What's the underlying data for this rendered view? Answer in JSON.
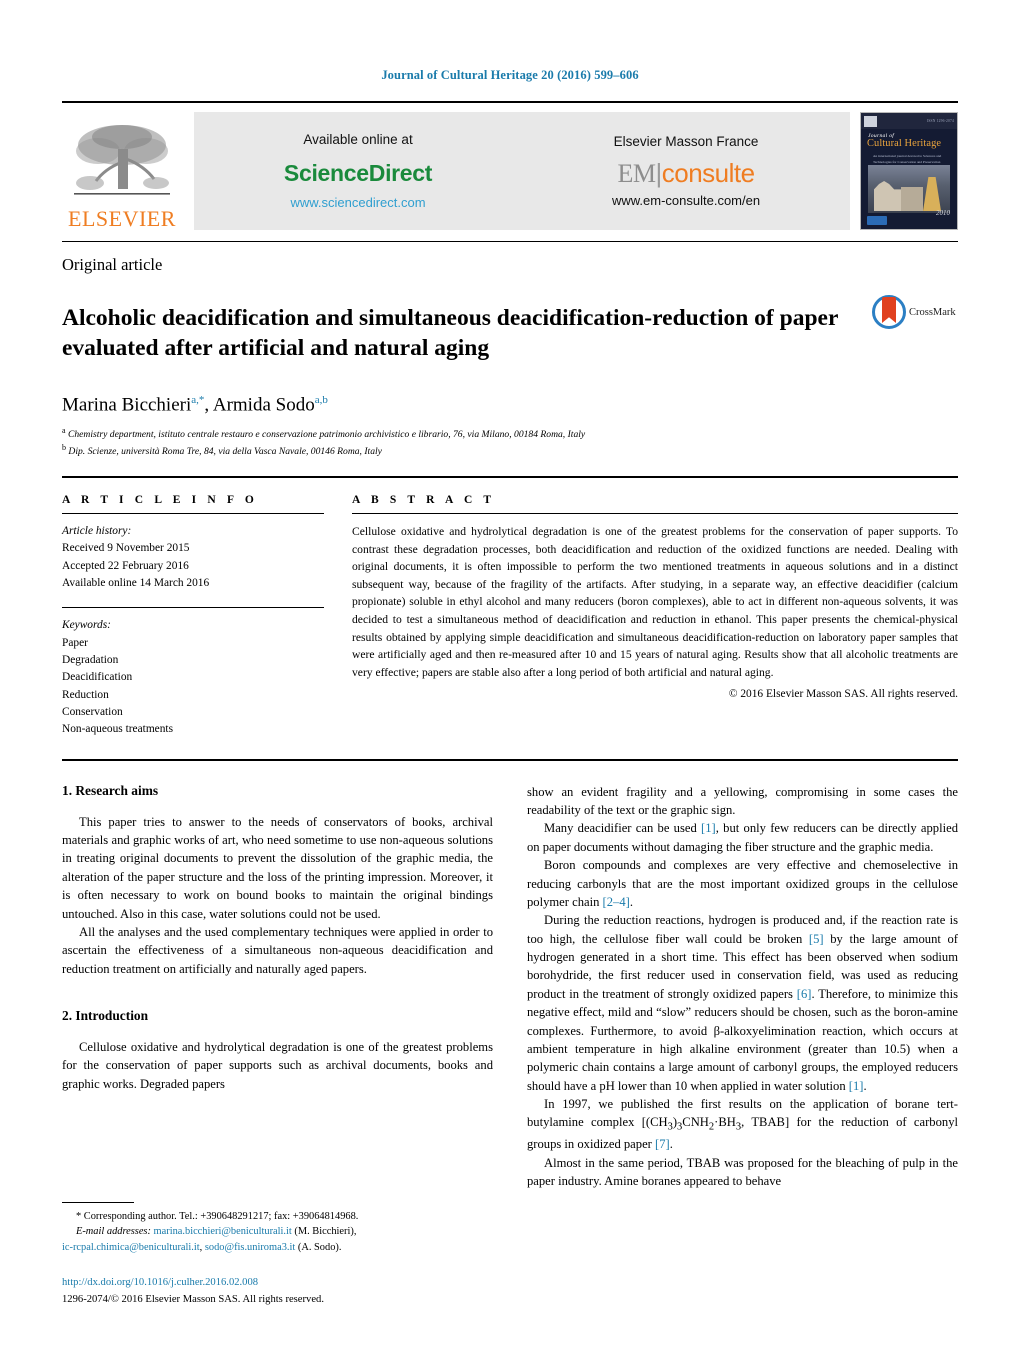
{
  "running_head": "Journal of Cultural Heritage 20 (2016) 599–606",
  "masthead": {
    "elsevier_wordmark": "ELSEVIER",
    "available_online": "Available online at",
    "sciencedirect": "ScienceDirect",
    "sciencedirect_url": "www.sciencedirect.com",
    "publisher": "Elsevier Masson France",
    "em_prefix": "EM",
    "em_suffix": "consulte",
    "em_url": "www.em-consulte.com/en",
    "cover": {
      "journal_word": "Journal of",
      "title": "Cultural Heritage",
      "subtitle": "An international journal devoted to Sciences and Technologies for Conservation and Preservation",
      "volume": "2010",
      "issn": "ISSN 1296-2074"
    }
  },
  "article_type": "Original article",
  "title": "Alcoholic deacidification and simultaneous deacidification-reduction of paper evaluated after artificial and natural aging",
  "crossmark_label": "CrossMark",
  "authors": {
    "author1": "Marina Bicchieri",
    "author1_sup": "a,*",
    "separator": ", ",
    "author2": "Armida Sodo",
    "author2_sup": "a,b"
  },
  "affiliations": [
    {
      "sup": "a",
      "text": "Chemistry department, istituto centrale restauro e conservazione patrimonio archivistico e librario, 76, via Milano, 00184 Roma, Italy"
    },
    {
      "sup": "b",
      "text": "Dip. Scienze, università Roma Tre, 84, via della Vasca Navale, 00146 Roma, Italy"
    }
  ],
  "article_info": {
    "label": "A R T I C L E   I N F O",
    "history_label": "Article history:",
    "received": "Received 9 November 2015",
    "accepted": "Accepted 22 February 2016",
    "available": "Available online 14 March 2016",
    "keywords_label": "Keywords:",
    "keywords": [
      "Paper",
      "Degradation",
      "Deacidification",
      "Reduction",
      "Conservation",
      "Non-aqueous treatments"
    ]
  },
  "abstract": {
    "label": "A B S T R A C T",
    "text": "Cellulose oxidative and hydrolytical degradation is one of the greatest problems for the conservation of paper supports. To contrast these degradation processes, both deacidification and reduction of the oxidized functions are needed. Dealing with original documents, it is often impossible to perform the two mentioned treatments in aqueous solutions and in a distinct subsequent way, because of the fragility of the artifacts. After studying, in a separate way, an effective deacidifier (calcium propionate) soluble in ethyl alcohol and many reducers (boron complexes), able to act in different non-aqueous solvents, it was decided to test a simultaneous method of deacidification and reduction in ethanol. This paper presents the chemical-physical results obtained by applying simple deacidification and simultaneous deacidification-reduction on laboratory paper samples that were artificially aged and then re-measured after 10 and 15 years of natural aging. Results show that all alcoholic treatments are very effective; papers are stable also after a long period of both artificial and natural aging.",
    "copyright": "© 2016 Elsevier Masson SAS. All rights reserved."
  },
  "body": {
    "section1_heading": "1.  Research aims",
    "section1_p1": "This paper tries to answer to the needs of conservators of books, archival materials and graphic works of art, who need sometime to use non-aqueous solutions in treating original documents to prevent the dissolution of the graphic media, the alteration of the paper structure and the loss of the printing impression. Moreover, it is often necessary to work on bound books to maintain the original bindings untouched. Also in this case, water solutions could not be used.",
    "section1_p2": "All the analyses and the used complementary techniques were applied in order to ascertain the effectiveness of a simultaneous non-aqueous deacidification and reduction treatment on artificially and naturally aged papers.",
    "section2_heading": "2.  Introduction",
    "section2_p1": "Cellulose oxidative and hydrolytical degradation is one of the greatest problems for the conservation of paper supports such as archival documents, books and graphic works. Degraded papers",
    "right_p1": "show an evident fragility and a yellowing, compromising in some cases the readability of the text or the graphic sign.",
    "right_p2_a": "Many deacidifier can be used ",
    "right_p2_ref1": "[1]",
    "right_p2_b": ", but only few reducers can be directly applied on paper documents without damaging the fiber structure and the graphic media.",
    "right_p3_a": "Boron compounds and complexes are very effective and chemoselective in reducing carbonyls that are the most important oxidized groups in the cellulose polymer chain ",
    "right_p3_ref": "[2–4]",
    "right_p3_b": ".",
    "right_p4_a": "During the reduction reactions, hydrogen is produced and, if the reaction rate is too high, the cellulose fiber wall could be broken ",
    "right_p4_ref1": "[5]",
    "right_p4_b": " by the large amount of hydrogen generated in a short time. This effect has been observed when sodium borohydride, the first reducer used in conservation field, was used as reducing product in the treatment of strongly oxidized papers ",
    "right_p4_ref2": "[6]",
    "right_p4_c": ". Therefore, to minimize this negative effect, mild and “slow” reducers should be chosen, such as the boron-amine complexes. Furthermore, to avoid β-alkoxyelimination reaction, which occurs at ambient temperature in high alkaline environment (greater than 10.5) when a polymeric chain contains a large amount of carbonyl groups, the employed reducers should have a pH lower than 10 when applied in water solution ",
    "right_p4_ref3": "[1]",
    "right_p4_d": ".",
    "right_p5_a": "In 1997, we published the first results on the application of borane tert-butylamine complex [(CH",
    "right_p5_sub1": "3",
    "right_p5_b": ")",
    "right_p5_sub2": "3",
    "right_p5_c": "CNH",
    "right_p5_sub3": "2",
    "right_p5_d": "·BH",
    "right_p5_sub4": "3",
    "right_p5_e": ", TBAB] for the reduction of carbonyl groups in oxidized paper ",
    "right_p5_ref": "[7]",
    "right_p5_f": ".",
    "right_p6": "Almost in the same period, TBAB was proposed for the bleaching of pulp in the paper industry. Amine boranes appeared to behave"
  },
  "footnote": {
    "corresponding": "*  Corresponding author. Tel.: +390648291217; fax: +39064814968.",
    "email_label": "E-mail addresses:",
    "email1": "marina.bicchieri@beniculturali.it",
    "email1_name": " (M. Bicchieri),",
    "email2": "ic-rcpal.chimica@beniculturali.it",
    "email2_sep": ", ",
    "email3": "sodo@fis.uniroma3.it",
    "email3_name": " (A. Sodo).",
    "doi": "http://dx.doi.org/10.1016/j.culher.2016.02.008",
    "issn_line": "1296-2074/© 2016 Elsevier Masson SAS. All rights reserved."
  },
  "colors": {
    "link_blue": "#1a7bab",
    "elsevier_orange": "#ef7d22",
    "sciencedirect_green": "#1a8a3c",
    "crossmark_blue": "#2b7fc4",
    "crossmark_red": "#e0411f"
  }
}
